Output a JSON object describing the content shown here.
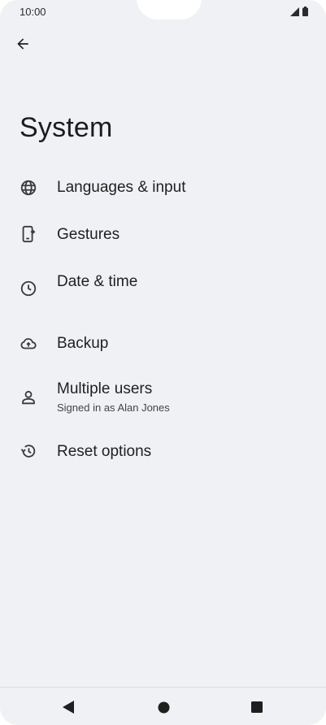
{
  "status_bar": {
    "time": "10:00"
  },
  "page": {
    "title": "System"
  },
  "items": [
    {
      "label": "Languages & input",
      "icon": "globe-icon"
    },
    {
      "label": "Gestures",
      "icon": "phone-gesture-icon"
    },
    {
      "label": "Date & time",
      "icon": "clock-icon"
    },
    {
      "label": "Backup",
      "icon": "cloud-upload-icon"
    },
    {
      "label": "Multiple users",
      "subtitle": "Signed in as Alan Jones",
      "icon": "person-icon"
    },
    {
      "label": "Reset options",
      "icon": "history-icon"
    }
  ],
  "nav": {
    "back": "back-triangle-icon",
    "home": "home-circle-icon",
    "recents": "recents-square-icon"
  },
  "colors": {
    "background": "#f0f1f4",
    "text": "#1f1f1f",
    "icon": "#3b3b3b"
  }
}
